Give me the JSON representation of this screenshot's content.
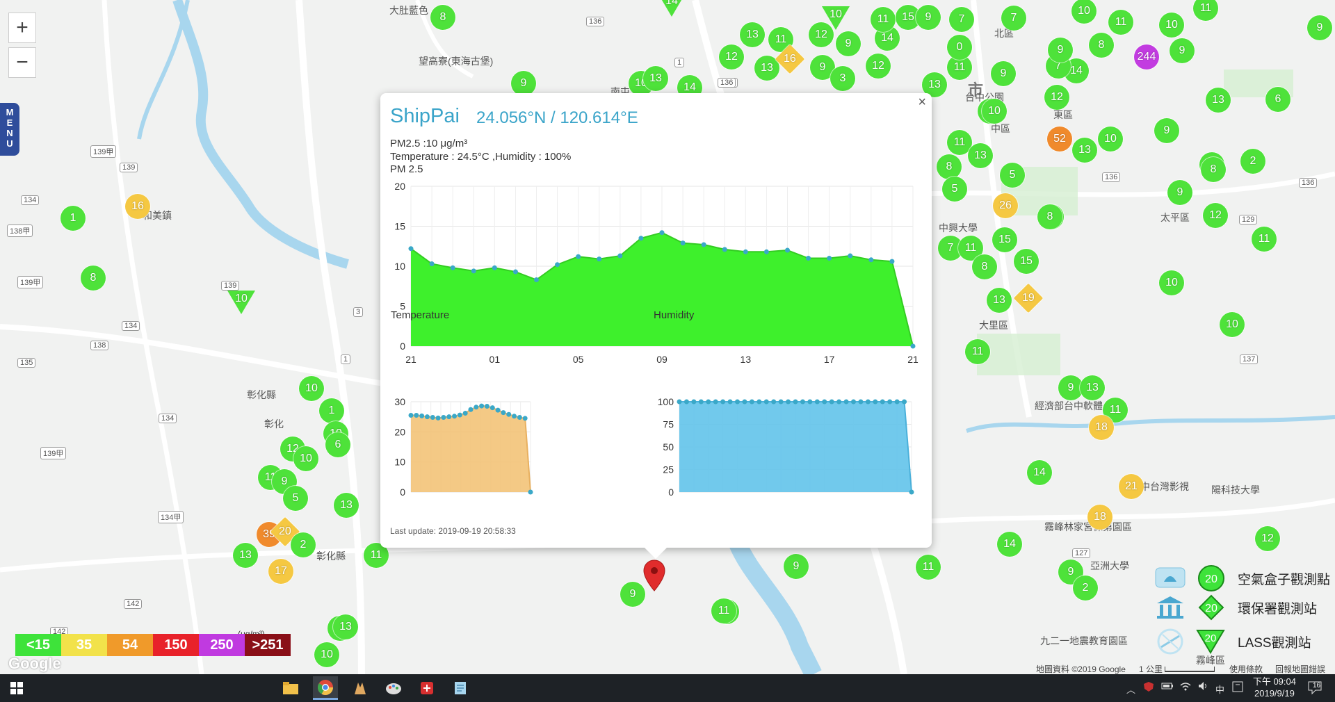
{
  "map": {
    "zoom_in": "+",
    "zoom_out": "−",
    "menu_label": "MENU",
    "labels": [
      {
        "t": "大肚藍色",
        "c": "mlabel"
      },
      {
        "t": "望高寮(東海古堡)",
        "c": "mlabel"
      },
      {
        "t": "和美鎮",
        "c": "mlabel"
      },
      {
        "t": "彰化縣",
        "c": "mlabel"
      },
      {
        "t": "北區",
        "c": "mlabel"
      },
      {
        "t": "中區",
        "c": "mlabel"
      },
      {
        "t": "東區",
        "c": "mlabel"
      },
      {
        "t": "市",
        "c": "mlabel big"
      },
      {
        "t": "太平區",
        "c": "mlabel"
      },
      {
        "t": "大里區",
        "c": "mlabel"
      },
      {
        "t": "霧峰林家宮保第園區",
        "c": "mlabel"
      },
      {
        "t": "亞洲大學",
        "c": "mlabel"
      },
      {
        "t": "九二一地震教育園區",
        "c": "mlabel"
      },
      {
        "t": "霧峰區",
        "c": "mlabel"
      },
      {
        "t": "中興大學",
        "c": "mlabel"
      },
      {
        "t": "經濟部台中軟體",
        "c": "mlabel"
      },
      {
        "t": "陽科技大學",
        "c": "mlabel"
      },
      {
        "t": "彰化縣",
        "c": "mlabel"
      },
      {
        "t": "台中公園",
        "c": "mlabel"
      },
      {
        "t": "南屯",
        "c": "mlabel"
      },
      {
        "t": "彰化",
        "c": "mlabel"
      },
      {
        "t": "中台灣影視",
        "c": "mlabel"
      }
    ],
    "shields": [
      "136",
      "136",
      "139",
      "139甲",
      "134",
      "138甲",
      "139甲",
      "134",
      "138",
      "135",
      "142",
      "142",
      "134甲",
      "134",
      "139",
      "139甲",
      "3",
      "1",
      "127",
      "129",
      "136",
      "136",
      "137",
      "1",
      "136"
    ],
    "markers": [
      {
        "v": "8",
        "c": "#4ee23a",
        "s": "c"
      },
      {
        "v": "9",
        "c": "#4ee23a",
        "s": "c"
      },
      {
        "v": "14",
        "c": "#4ee23a",
        "s": "t"
      },
      {
        "v": "13",
        "c": "#4ee23a",
        "s": "c"
      },
      {
        "v": "10",
        "c": "#4ee23a",
        "s": "c"
      },
      {
        "v": "13",
        "c": "#4ee23a",
        "s": "c"
      },
      {
        "v": "12",
        "c": "#4ee23a",
        "s": "c"
      },
      {
        "v": "13",
        "c": "#4ee23a",
        "s": "c"
      },
      {
        "v": "11",
        "c": "#4ee23a",
        "s": "c"
      },
      {
        "v": "16",
        "c": "#f5c842",
        "s": "d"
      },
      {
        "v": "9",
        "c": "#4ee23a",
        "s": "c"
      },
      {
        "v": "3",
        "c": "#4ee23a",
        "s": "c"
      },
      {
        "v": "10",
        "c": "#4ee23a",
        "s": "t"
      },
      {
        "v": "12",
        "c": "#4ee23a",
        "s": "c"
      },
      {
        "v": "9",
        "c": "#4ee23a",
        "s": "c"
      },
      {
        "v": "14",
        "c": "#4ee23a",
        "s": "c"
      },
      {
        "v": "11",
        "c": "#4ee23a",
        "s": "c"
      },
      {
        "v": "15",
        "c": "#4ee23a",
        "s": "c"
      },
      {
        "v": "9",
        "c": "#4ee23a",
        "s": "c"
      },
      {
        "v": "7",
        "c": "#4ee23a",
        "s": "c"
      },
      {
        "v": "12",
        "c": "#4ee23a",
        "s": "c"
      },
      {
        "v": "11",
        "c": "#4ee23a",
        "s": "c"
      },
      {
        "v": "0",
        "c": "#4ee23a",
        "s": "c"
      },
      {
        "v": "13",
        "c": "#4ee23a",
        "s": "c"
      },
      {
        "v": "9",
        "c": "#4ee23a",
        "s": "c"
      },
      {
        "v": "7",
        "c": "#4ee23a",
        "s": "c"
      },
      {
        "v": "14",
        "c": "#4ee23a",
        "s": "c"
      },
      {
        "v": "10",
        "c": "#4ee23a",
        "s": "c"
      },
      {
        "v": "7",
        "c": "#4ee23a",
        "s": "c"
      },
      {
        "v": "10",
        "c": "#4ee23a",
        "s": "c"
      },
      {
        "v": "11",
        "c": "#4ee23a",
        "s": "c"
      },
      {
        "v": "10",
        "c": "#4ee23a",
        "s": "c"
      },
      {
        "v": "11",
        "c": "#4ee23a",
        "s": "c"
      },
      {
        "v": "8",
        "c": "#4ee23a",
        "s": "c"
      },
      {
        "v": "9",
        "c": "#4ee23a",
        "s": "c"
      },
      {
        "v": "244",
        "c": "#c23ce0",
        "s": "c"
      },
      {
        "v": "9",
        "c": "#4ee23a",
        "s": "c"
      },
      {
        "v": "9",
        "c": "#4ee23a",
        "s": "c"
      },
      {
        "v": "12",
        "c": "#4ee23a",
        "s": "c"
      },
      {
        "v": "10",
        "c": "#4ee23a",
        "s": "c"
      },
      {
        "v": "13",
        "c": "#4ee23a",
        "s": "c"
      },
      {
        "v": "6",
        "c": "#4ee23a",
        "s": "c"
      },
      {
        "v": "52",
        "c": "#f08a2c",
        "s": "c"
      },
      {
        "v": "10",
        "c": "#4ee23a",
        "s": "c"
      },
      {
        "v": "13",
        "c": "#4ee23a",
        "s": "c"
      },
      {
        "v": "9",
        "c": "#4ee23a",
        "s": "c"
      },
      {
        "v": "11",
        "c": "#4ee23a",
        "s": "c"
      },
      {
        "v": "13",
        "c": "#4ee23a",
        "s": "c"
      },
      {
        "v": "8",
        "c": "#4ee23a",
        "s": "c"
      },
      {
        "v": "5",
        "c": "#4ee23a",
        "s": "c"
      },
      {
        "v": "5",
        "c": "#4ee23a",
        "s": "c"
      },
      {
        "v": "7",
        "c": "#4ee23a",
        "s": "c"
      },
      {
        "v": "8",
        "c": "#4ee23a",
        "s": "c"
      },
      {
        "v": "2",
        "c": "#4ee23a",
        "s": "c"
      },
      {
        "v": "9",
        "c": "#4ee23a",
        "s": "c"
      },
      {
        "v": "26",
        "c": "#f5c842",
        "s": "c"
      },
      {
        "v": "12",
        "c": "#4ee23a",
        "s": "c"
      },
      {
        "v": "8",
        "c": "#4ee23a",
        "s": "c"
      },
      {
        "v": "12",
        "c": "#4ee23a",
        "s": "c"
      },
      {
        "v": "11",
        "c": "#4ee23a",
        "s": "c"
      },
      {
        "v": "15",
        "c": "#4ee23a",
        "s": "c"
      },
      {
        "v": "7",
        "c": "#4ee23a",
        "s": "c"
      },
      {
        "v": "11",
        "c": "#4ee23a",
        "s": "c"
      },
      {
        "v": "8",
        "c": "#4ee23a",
        "s": "c"
      },
      {
        "v": "15",
        "c": "#4ee23a",
        "s": "c"
      },
      {
        "v": "10",
        "c": "#4ee23a",
        "s": "c"
      },
      {
        "v": "13",
        "c": "#4ee23a",
        "s": "c"
      },
      {
        "v": "19",
        "c": "#f5c842",
        "s": "d"
      },
      {
        "v": "11",
        "c": "#4ee23a",
        "s": "c"
      },
      {
        "v": "10",
        "c": "#4ee23a",
        "s": "c"
      },
      {
        "v": "9",
        "c": "#4ee23a",
        "s": "c"
      },
      {
        "v": "13",
        "c": "#4ee23a",
        "s": "c"
      },
      {
        "v": "11",
        "c": "#4ee23a",
        "s": "c"
      },
      {
        "v": "18",
        "c": "#f5c842",
        "s": "c"
      },
      {
        "v": "14",
        "c": "#4ee23a",
        "s": "c"
      },
      {
        "v": "21",
        "c": "#f5c842",
        "s": "c"
      },
      {
        "v": "18",
        "c": "#f5c842",
        "s": "c"
      },
      {
        "v": "12",
        "c": "#4ee23a",
        "s": "c"
      },
      {
        "v": "14",
        "c": "#4ee23a",
        "s": "c"
      },
      {
        "v": "9",
        "c": "#4ee23a",
        "s": "c"
      },
      {
        "v": "2",
        "c": "#4ee23a",
        "s": "c"
      },
      {
        "v": "11",
        "c": "#4ee23a",
        "s": "c"
      },
      {
        "v": "9",
        "c": "#4ee23a",
        "s": "c"
      },
      {
        "v": "10",
        "c": "#4ee23a",
        "s": "c"
      },
      {
        "v": "14",
        "c": "#4ee23a",
        "s": "c"
      },
      {
        "v": "16",
        "c": "#f5c842",
        "s": "c"
      },
      {
        "v": "1",
        "c": "#4ee23a",
        "s": "c"
      },
      {
        "v": "8",
        "c": "#4ee23a",
        "s": "c"
      },
      {
        "v": "10",
        "c": "#4ee23a",
        "s": "t"
      },
      {
        "v": "10",
        "c": "#4ee23a",
        "s": "c"
      },
      {
        "v": "1",
        "c": "#4ee23a",
        "s": "c"
      },
      {
        "v": "10",
        "c": "#4ee23a",
        "s": "c"
      },
      {
        "v": "12",
        "c": "#4ee23a",
        "s": "c"
      },
      {
        "v": "6",
        "c": "#4ee23a",
        "s": "c"
      },
      {
        "v": "10",
        "c": "#4ee23a",
        "s": "c"
      },
      {
        "v": "11",
        "c": "#4ee23a",
        "s": "c"
      },
      {
        "v": "9",
        "c": "#4ee23a",
        "s": "c"
      },
      {
        "v": "5",
        "c": "#4ee23a",
        "s": "c"
      },
      {
        "v": "13",
        "c": "#4ee23a",
        "s": "c"
      },
      {
        "v": "39",
        "c": "#f08a2c",
        "s": "c"
      },
      {
        "v": "20",
        "c": "#f5c842",
        "s": "d"
      },
      {
        "v": "2",
        "c": "#4ee23a",
        "s": "c"
      },
      {
        "v": "13",
        "c": "#4ee23a",
        "s": "c"
      },
      {
        "v": "17",
        "c": "#f5c842",
        "s": "c"
      },
      {
        "v": "11",
        "c": "#4ee23a",
        "s": "c"
      },
      {
        "v": "11",
        "c": "#4ee23a",
        "s": "c"
      },
      {
        "v": "13",
        "c": "#4ee23a",
        "s": "c"
      },
      {
        "v": "10",
        "c": "#4ee23a",
        "s": "c"
      },
      {
        "v": "11",
        "c": "#4ee23a",
        "s": "c"
      },
      {
        "v": "9",
        "c": "#4ee23a",
        "s": "c"
      },
      {
        "v": "13",
        "c": "#4ee23a",
        "s": "c"
      }
    ]
  },
  "popup": {
    "close": "×",
    "title": "ShipPai",
    "coords": "24.056°N / 120.614°E",
    "pm_line": "PM2.5 :10 μg/m³",
    "env_line": "Temperature : 24.5°C ,Humidity : 100%",
    "last_update": "Last update: 2019-09-19 20:58:33"
  },
  "chart_data": [
    {
      "type": "area",
      "title": "PM 2.5",
      "color": "#3ef02c",
      "ylim": [
        0,
        20
      ],
      "yticks": [
        0,
        5,
        10,
        15,
        20
      ],
      "xticks": [
        "21",
        "01",
        "05",
        "09",
        "13",
        "17",
        "21"
      ],
      "grid": true,
      "values": [
        12.2,
        10.3,
        9.8,
        9.4,
        9.8,
        9.3,
        8.3,
        10.2,
        11.2,
        10.9,
        11.3,
        13.5,
        14.2,
        12.9,
        12.7,
        12.1,
        11.8,
        11.8,
        12.0,
        11.0,
        11.0,
        11.3,
        10.8,
        10.6,
        0
      ]
    },
    {
      "type": "area",
      "title": "Temperature",
      "color": "#f2c070",
      "ylim": [
        0,
        30
      ],
      "yticks": [
        0,
        10,
        20,
        30
      ],
      "grid": true,
      "values": [
        25.5,
        25.5,
        25.3,
        25.0,
        24.8,
        24.6,
        24.8,
        25.0,
        25.2,
        25.6,
        26.2,
        27.4,
        28.2,
        28.6,
        28.5,
        28.0,
        27.2,
        26.4,
        25.8,
        25.2,
        24.8,
        24.5,
        0
      ]
    },
    {
      "type": "area",
      "title": "Humidity",
      "color": "#62c3ea",
      "ylim": [
        0,
        100
      ],
      "yticks": [
        0,
        25,
        50,
        75,
        100
      ],
      "grid": true,
      "values": [
        100,
        100,
        100,
        100,
        100,
        100,
        100,
        100,
        100,
        100,
        100,
        100,
        100,
        100,
        100,
        100,
        100,
        100,
        100,
        100,
        100,
        100,
        100,
        100,
        100,
        100,
        100,
        100,
        100,
        100,
        100,
        100,
        0
      ]
    }
  ],
  "aqi_scale": {
    "unit": "(μg/m³)",
    "cells": [
      {
        "t": "<15",
        "c": "#3ee33a"
      },
      {
        "t": "35",
        "c": "#f2e24a"
      },
      {
        "t": "54",
        "c": "#f09a2a"
      },
      {
        "t": "150",
        "c": "#e8222a"
      },
      {
        "t": "250",
        "c": "#c03ae0"
      },
      {
        "t": ">251",
        "c": "#8a1018"
      }
    ]
  },
  "google": "Google",
  "attribution": {
    "data": "地圖資料 ©2019 Google",
    "scale": "1 公里",
    "terms": "使用條款",
    "report": "回報地圖錯誤"
  },
  "legend": [
    {
      "label": "空氣盒子觀測點",
      "v": "20",
      "icon": "airbox-icon"
    },
    {
      "label": "環保署觀測站",
      "v": "20",
      "icon": "epa-building-icon"
    },
    {
      "label": "LASS觀測站",
      "v": "20",
      "icon": "lass-station-icon"
    }
  ],
  "taskbar": {
    "tray_ime": "中",
    "time": "下午 09:04",
    "date": "2019/9/19",
    "notif_count": "16"
  }
}
